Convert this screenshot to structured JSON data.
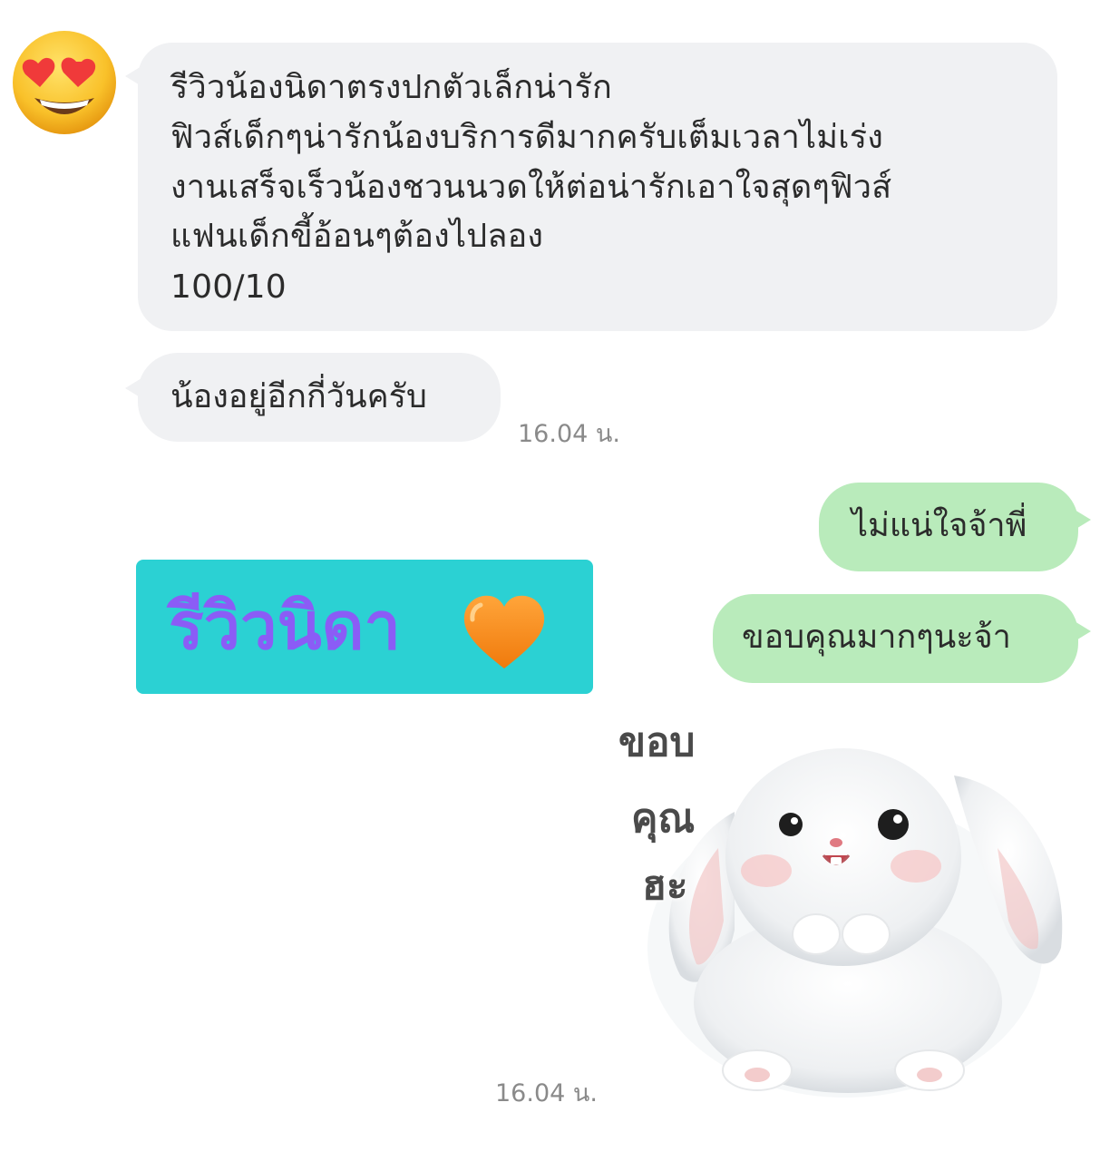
{
  "conversation": {
    "messages_in": [
      {
        "lines": [
          "รีวิวน้องนิดาตรงปกตัวเล็กน่ารัก",
          "ฟิวส์เด็กๆน่ารักน้องบริการดีมากครับเต็มเวลาไม่เร่ง",
          "งานเสร็จเร็วน้องชวนนวดให้ต่อน่ารักเอาใจสุดๆฟิวส์",
          "แฟนเด็กขี้อ้อนๆต้องไปลอง",
          "100/10"
        ]
      },
      {
        "text": "น้องอยู่อีกกี่วันครับ",
        "time": "16.04 น."
      }
    ],
    "messages_out": [
      {
        "text": "ไม่แน่ใจจ้าพี่"
      },
      {
        "text": "ขอบคุณมากๆนะจ้า"
      }
    ],
    "banner": {
      "text": "รีวิวนิดา",
      "emoji_icon": "orange-heart-icon",
      "background": "#2bd1d3",
      "text_color": "#8b5cf6"
    },
    "sticker": {
      "icon": "bunny-sticker-icon",
      "words": [
        "ขอบ",
        "คุณ",
        "ฮะ"
      ]
    },
    "sticker_time": "16.04 น.",
    "avatar_icon": "heart-eyes-emoji-icon"
  },
  "colors": {
    "incoming_bubble": "#f0f1f3",
    "outgoing_bubble": "#b9ebbb",
    "timestamp": "#8a8a8a"
  }
}
